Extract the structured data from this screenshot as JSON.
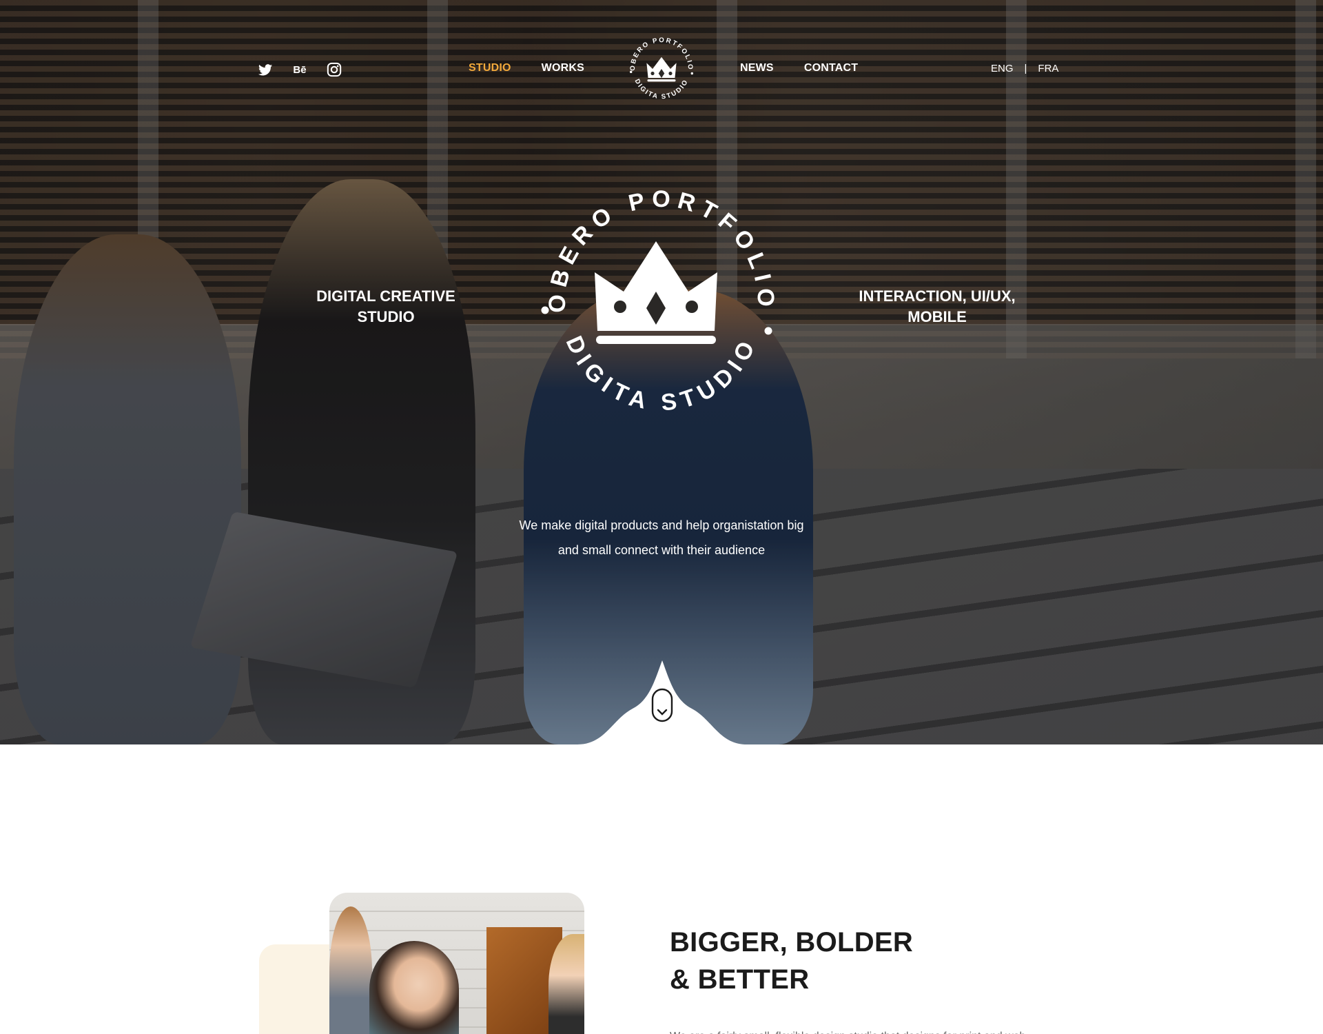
{
  "brand": {
    "logo_ring_text_top": "OBERO PORTFOLIO",
    "logo_ring_text_bottom": "DIGITA STUDIO"
  },
  "social": [
    {
      "icon": "twitter-icon"
    },
    {
      "icon": "behance-icon",
      "glyph": "Bē"
    },
    {
      "icon": "instagram-icon"
    }
  ],
  "nav": {
    "left": [
      {
        "label": "STUDIO",
        "active": true
      },
      {
        "label": "WORKS",
        "active": false
      }
    ],
    "right": [
      {
        "label": "NEWS",
        "active": false
      },
      {
        "label": "CONTACT",
        "active": false
      }
    ]
  },
  "lang": {
    "options": [
      "ENG",
      "FRA"
    ],
    "separator": "|"
  },
  "hero": {
    "left_title_line1": "DIGITAL CREATIVE",
    "left_title_line2": "STUDIO",
    "right_title_line1": "INTERACTION, UI/UX,",
    "right_title_line2": "MOBILE",
    "tagline_line1": "We make digital products and help organistation big",
    "tagline_line2": "and small connect with their audience"
  },
  "about": {
    "headline_line1": "BIGGER, BOLDER",
    "headline_line2": "& BETTER",
    "paragraph": "We are a fairly small, flexible design studio that designs for print and web."
  },
  "colors": {
    "accent": "#f2a93b",
    "dark_text": "#1b1b1b",
    "cream": "#fbf3e4"
  }
}
